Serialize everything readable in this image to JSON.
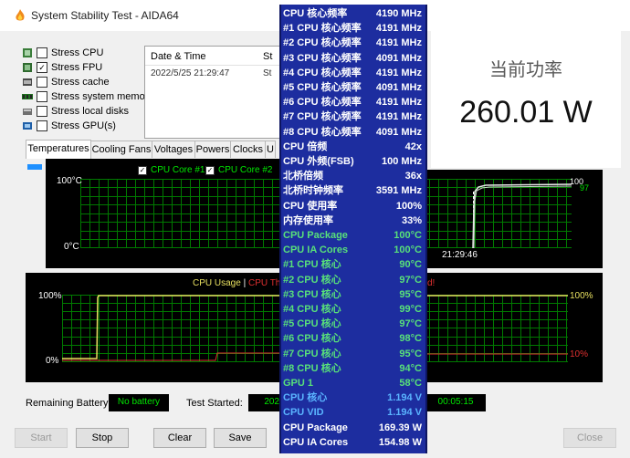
{
  "window": {
    "title": "System Stability Test - AIDA64"
  },
  "stress_options": [
    {
      "label": "Stress CPU",
      "checked": false,
      "icon": "cpu-icon"
    },
    {
      "label": "Stress FPU",
      "checked": true,
      "icon": "fpu-icon"
    },
    {
      "label": "Stress cache",
      "checked": false,
      "icon": "cache-icon"
    },
    {
      "label": "Stress system memory",
      "checked": false,
      "icon": "memory-icon"
    },
    {
      "label": "Stress local disks",
      "checked": false,
      "icon": "disk-icon"
    },
    {
      "label": "Stress GPU(s)",
      "checked": false,
      "icon": "gpu-icon"
    }
  ],
  "log": {
    "col_datetime": "Date & Time",
    "col_status": "St",
    "rows": [
      {
        "datetime": "2022/5/25 21:29:47",
        "status": "St"
      }
    ]
  },
  "tabs": [
    "Temperatures",
    "Cooling Fans",
    "Voltages",
    "Powers",
    "Clocks",
    "U"
  ],
  "temp_graph": {
    "legend": [
      "CPU Core #1",
      "CPU Core #2"
    ],
    "y_top": "100°C",
    "y_bottom": "0°C",
    "time_label": "21:29:46",
    "right_values": [
      "100",
      "97"
    ]
  },
  "usage_graph": {
    "legend_usage": "CPU Usage",
    "legend_sep": "|",
    "legend_throttle": "CPU Th",
    "legend_end": "d!",
    "y_top_left": "100%",
    "y_bottom_left": "0%",
    "y_top_right": "100%",
    "y_bottom_right": "10%"
  },
  "status_bar": {
    "battery_label": "Remaining Battery:",
    "battery_value": "No battery",
    "started_label": "Test Started:",
    "started_value": "202",
    "elapsed_value": "00:05:15"
  },
  "buttons": {
    "start": "Start",
    "stop": "Stop",
    "clear": "Clear",
    "save": "Save",
    "close": "Close"
  },
  "overlay_rows": [
    {
      "k": "CPU 核心频率",
      "v": "4190 MHz",
      "color": "#ffffff"
    },
    {
      "k": "#1 CPU 核心频率",
      "v": "4191 MHz",
      "color": "#ffffff"
    },
    {
      "k": "#2 CPU 核心频率",
      "v": "4191 MHz",
      "color": "#ffffff"
    },
    {
      "k": "#3 CPU 核心频率",
      "v": "4091 MHz",
      "color": "#ffffff"
    },
    {
      "k": "#4 CPU 核心频率",
      "v": "4191 MHz",
      "color": "#ffffff"
    },
    {
      "k": "#5 CPU 核心频率",
      "v": "4091 MHz",
      "color": "#ffffff"
    },
    {
      "k": "#6 CPU 核心频率",
      "v": "4191 MHz",
      "color": "#ffffff"
    },
    {
      "k": "#7 CPU 核心频率",
      "v": "4191 MHz",
      "color": "#ffffff"
    },
    {
      "k": "#8 CPU 核心频率",
      "v": "4091 MHz",
      "color": "#ffffff"
    },
    {
      "k": "CPU 倍频",
      "v": "42x",
      "color": "#ffffff"
    },
    {
      "k": "CPU 外频(FSB)",
      "v": "100 MHz",
      "color": "#ffffff"
    },
    {
      "k": "北桥倍频",
      "v": "36x",
      "color": "#ffffff"
    },
    {
      "k": "北桥时钟频率",
      "v": "3591 MHz",
      "color": "#ffffff"
    },
    {
      "k": "CPU 使用率",
      "v": "100%",
      "color": "#ffffff"
    },
    {
      "k": "内存使用率",
      "v": "33%",
      "color": "#ffffff"
    },
    {
      "k": "CPU Package",
      "v": "100°C",
      "color": "#58e07a"
    },
    {
      "k": "CPU IA Cores",
      "v": "100°C",
      "color": "#58e07a"
    },
    {
      "k": " #1 CPU 核心",
      "v": "90°C",
      "color": "#58e07a"
    },
    {
      "k": " #2 CPU 核心",
      "v": "97°C",
      "color": "#58e07a"
    },
    {
      "k": " #3 CPU 核心",
      "v": "95°C",
      "color": "#58e07a"
    },
    {
      "k": " #4 CPU 核心",
      "v": "99°C",
      "color": "#58e07a"
    },
    {
      "k": " #5 CPU 核心",
      "v": "97°C",
      "color": "#58e07a"
    },
    {
      "k": " #6 CPU 核心",
      "v": "98°C",
      "color": "#58e07a"
    },
    {
      "k": " #7 CPU 核心",
      "v": "95°C",
      "color": "#58e07a"
    },
    {
      "k": " #8 CPU 核心",
      "v": "94°C",
      "color": "#58e07a"
    },
    {
      "k": "GPU 1",
      "v": "58°C",
      "color": "#58e07a"
    },
    {
      "k": "CPU 核心",
      "v": "1.194 V",
      "color": "#5ab4ff"
    },
    {
      "k": "CPU VID",
      "v": "1.194 V",
      "color": "#5ab4ff"
    },
    {
      "k": "CPU Package",
      "v": "169.39 W",
      "color": "#ffffff"
    },
    {
      "k": "CPU IA Cores",
      "v": "154.98 W",
      "color": "#ffffff"
    }
  ],
  "power_panel": {
    "label": "当前功率",
    "value": "260.01 W"
  },
  "colors": {
    "overlay_bg": "#1d2d9f",
    "graph_grid": "#007a00",
    "temp_label": "#00e800"
  }
}
